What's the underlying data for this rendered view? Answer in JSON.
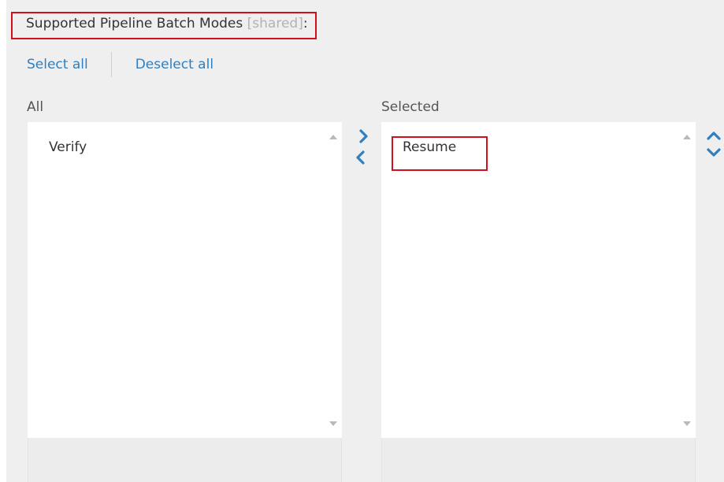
{
  "field": {
    "label": "Supported Pipeline Batch Modes",
    "shared_tag": "[shared]",
    "colon": ":"
  },
  "links": {
    "select_all": "Select all",
    "deselect_all": "Deselect all"
  },
  "lists": {
    "all": {
      "label": "All",
      "items": [
        "Verify"
      ]
    },
    "selected": {
      "label": "Selected",
      "items": [
        "Resume"
      ]
    }
  },
  "icons": {
    "move_right": "chevron-right-icon",
    "move_left": "chevron-left-icon",
    "move_up": "chevron-up-icon",
    "move_down": "chevron-down-icon"
  },
  "colors": {
    "accent": "#2f7fc1",
    "highlight": "#d0101d",
    "panel_bg": "#efefef"
  }
}
